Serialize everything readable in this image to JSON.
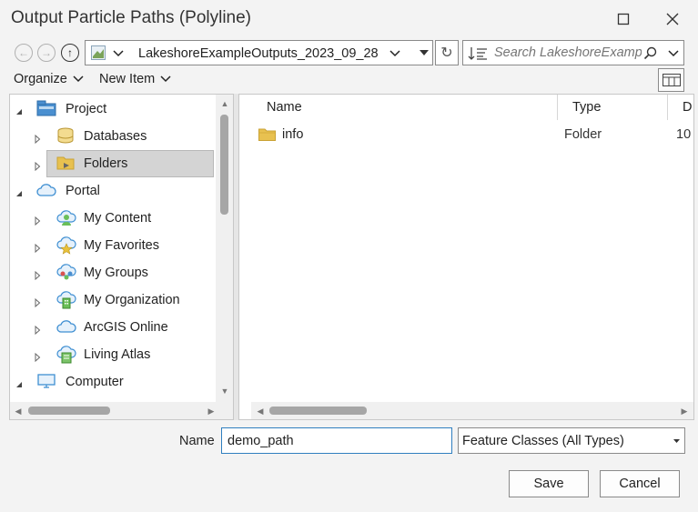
{
  "window": {
    "title": "Output Particle Paths (Polyline)",
    "maximize_icon": "maximize-icon",
    "close_icon": "close-icon"
  },
  "nav": {
    "current_location": "LakeshoreExampleOutputs_2023_09_28",
    "search_placeholder": "Search LakeshoreExamp"
  },
  "toolbar": {
    "organize_label": "Organize",
    "new_item_label": "New Item"
  },
  "tree": {
    "items": [
      {
        "label": "Project",
        "icon": "project-icon"
      },
      {
        "label": "Databases",
        "icon": "database-icon"
      },
      {
        "label": "Folders",
        "icon": "folder-icon"
      },
      {
        "label": "Portal",
        "icon": "portal-cloud-icon"
      },
      {
        "label": "My Content",
        "icon": "my-content-icon"
      },
      {
        "label": "My Favorites",
        "icon": "favorites-icon"
      },
      {
        "label": "My Groups",
        "icon": "groups-icon"
      },
      {
        "label": "My Organization",
        "icon": "organization-icon"
      },
      {
        "label": "ArcGIS Online",
        "icon": "arcgis-online-icon"
      },
      {
        "label": "Living Atlas",
        "icon": "living-atlas-icon"
      },
      {
        "label": "Computer",
        "icon": "computer-icon"
      }
    ],
    "selected": "Folders"
  },
  "list": {
    "columns": [
      "Name",
      "Type",
      "D"
    ],
    "rows": [
      {
        "name": "info",
        "type": "Folder",
        "date": "10"
      }
    ]
  },
  "footer": {
    "name_label": "Name",
    "name_value": "demo_path",
    "filter_value": "Feature Classes (All Types)",
    "save_label": "Save",
    "cancel_label": "Cancel"
  },
  "colors": {
    "accent": "#2f7fbf",
    "selection": "#d4d4d4",
    "folder": "#e8c150"
  }
}
